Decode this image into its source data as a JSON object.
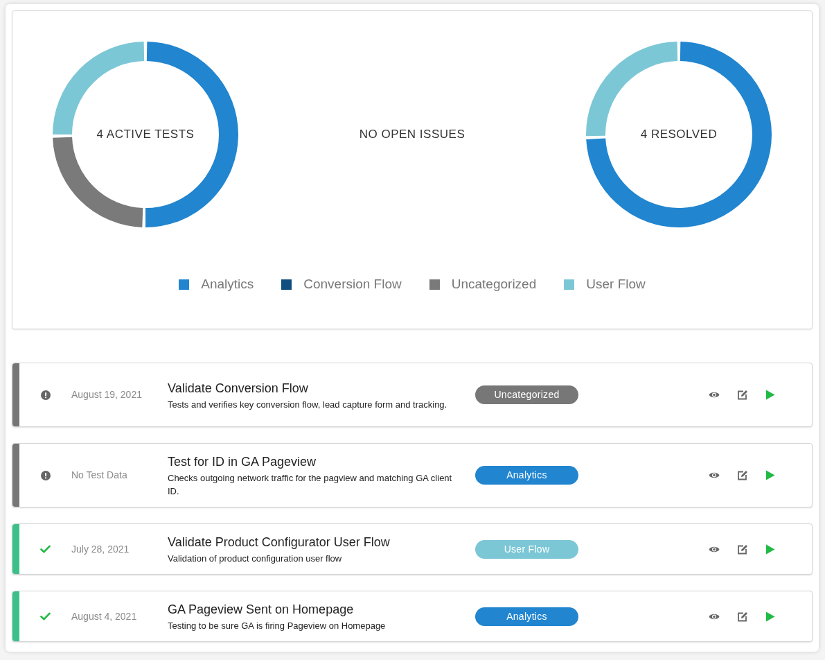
{
  "summary": {
    "active_tests": {
      "label": "4 ACTIVE TESTS"
    },
    "issues": {
      "label": "NO OPEN ISSUES"
    },
    "resolved": {
      "label": "4 RESOLVED"
    },
    "legend": [
      {
        "label": "Analytics",
        "color": "#2185d0"
      },
      {
        "label": "Conversion Flow",
        "color": "#104e7f"
      },
      {
        "label": "Uncategorized",
        "color": "#7a7a7a"
      },
      {
        "label": "User Flow",
        "color": "#7cc7d6"
      }
    ]
  },
  "tests": [
    {
      "kind": "warning",
      "date": "August 19, 2021",
      "title": "Validate Conversion Flow",
      "description": "Tests and verifies key conversion flow, lead capture form and tracking.",
      "category": {
        "label": "Uncategorized",
        "color": "#777777"
      }
    },
    {
      "kind": "warning",
      "date": "No Test Data",
      "title": "Test for ID in GA Pageview",
      "description": "Checks outgoing network traffic for the pagview and matching GA client ID.",
      "category": {
        "label": "Analytics",
        "color": "#2185d0"
      }
    },
    {
      "kind": "passed",
      "date": "July 28, 2021",
      "title": "Validate Product Configurator User Flow",
      "description": "Validation of product configuration user flow",
      "category": {
        "label": "User Flow",
        "color": "#7cc7d6"
      }
    },
    {
      "kind": "passed",
      "date": "August 4, 2021",
      "title": "GA Pageview Sent on Homepage",
      "description": "Testing to be sure GA is firing Pageview on Homepage",
      "category": {
        "label": "Analytics",
        "color": "#2185d0"
      }
    }
  ]
}
